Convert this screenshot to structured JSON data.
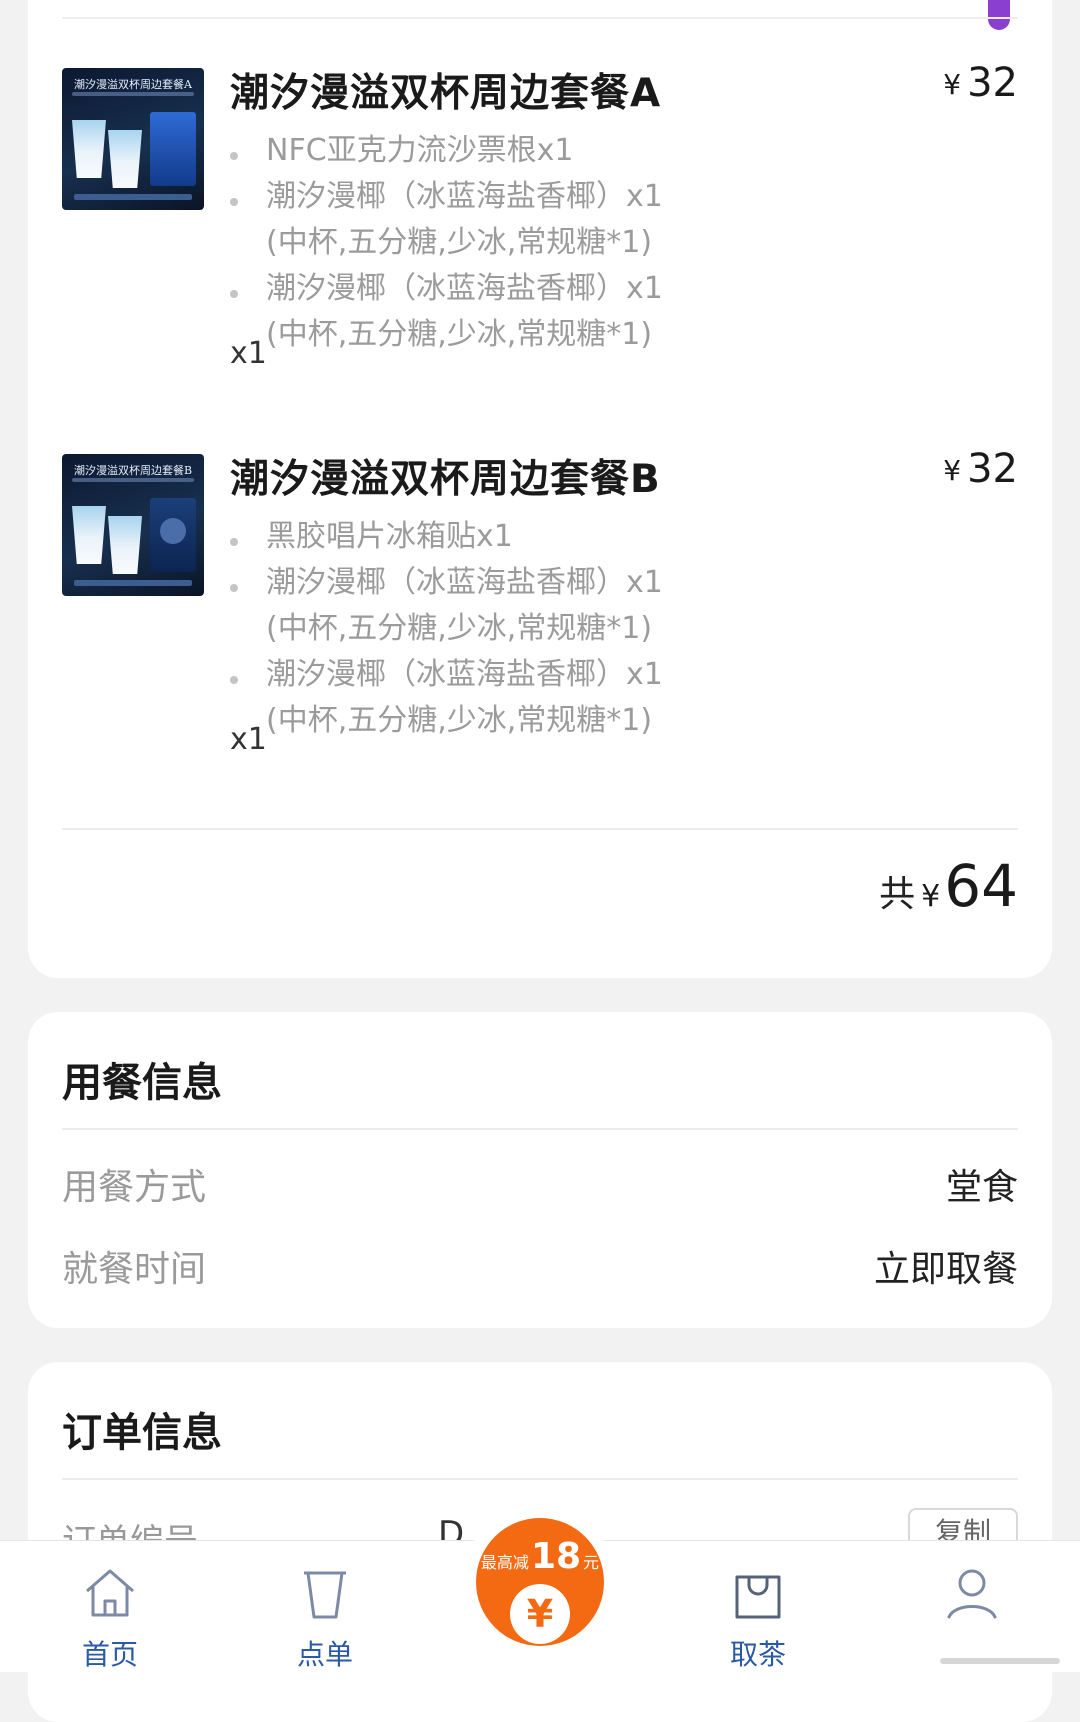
{
  "items": [
    {
      "name": "潮汐漫溢双杯周边套餐A",
      "price": "32",
      "currency": "¥",
      "thumb_title": "潮汐漫溢双杯周边套餐A",
      "subs": [
        {
          "text": "NFC亚克力流沙票根x1",
          "spec": ""
        },
        {
          "text": "潮汐漫椰（冰蓝海盐香椰）x1",
          "spec": "(中杯,五分糖,少冰,常规糖*1)"
        },
        {
          "text": "潮汐漫椰（冰蓝海盐香椰）x1",
          "spec": "(中杯,五分糖,少冰,常规糖*1)"
        }
      ],
      "qty": "x1"
    },
    {
      "name": "潮汐漫溢双杯周边套餐B",
      "price": "32",
      "currency": "¥",
      "thumb_title": "潮汐漫溢双杯周边套餐B",
      "subs": [
        {
          "text": "黑胶唱片冰箱贴x1",
          "spec": ""
        },
        {
          "text": "潮汐漫椰（冰蓝海盐香椰）x1",
          "spec": "(中杯,五分糖,少冰,常规糖*1)"
        },
        {
          "text": "潮汐漫椰（冰蓝海盐香椰）x1",
          "spec": "(中杯,五分糖,少冰,常规糖*1)"
        }
      ],
      "qty": "x1"
    }
  ],
  "total": {
    "label": "共",
    "currency": "¥",
    "value": "64"
  },
  "dining": {
    "title": "用餐信息",
    "rows": [
      {
        "label": "用餐方式",
        "value": "堂食"
      },
      {
        "label": "就餐时间",
        "value": "立即取餐"
      }
    ]
  },
  "order": {
    "title": "订单信息",
    "number_label": "订单编号",
    "number_value": "D",
    "copy_label": "复制"
  },
  "tabbar": {
    "home": "首页",
    "menu": "点单",
    "pickup": "取茶",
    "promo_prefix": "最高减",
    "promo_amount": "18",
    "promo_unit": "元",
    "promo_coin": "¥"
  },
  "colors": {
    "accent_blue": "#2a59a8",
    "promo_orange": "#f36a12",
    "muted_text": "#9b9b9b"
  }
}
